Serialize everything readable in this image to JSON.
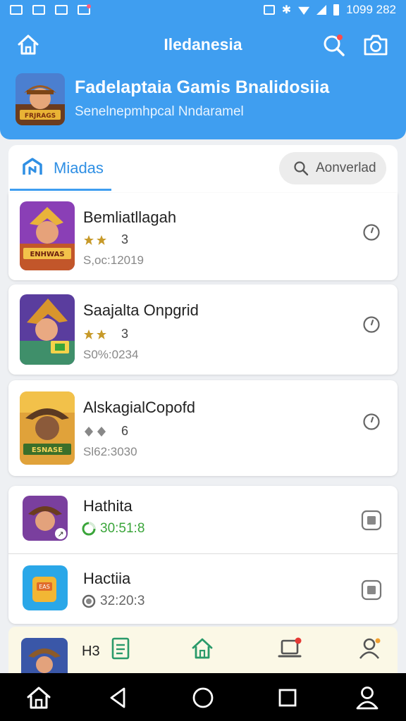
{
  "status_bar": {
    "time": "1099 282",
    "left_icons": [
      "image-icon",
      "chart-icon",
      "photo-icon",
      "gift-icon"
    ],
    "right_icons": [
      "nfc-icon",
      "vibrate-icon",
      "wifi-icon",
      "signal-icon",
      "battery-icon"
    ]
  },
  "header": {
    "title": "Iledanesia",
    "banner_title": "Fadelaptaia Gamis Bnalidosiia",
    "banner_subtitle": "Senelnepmhpcal Nndaramel"
  },
  "tabs": {
    "active_label": "Miadas",
    "search_placeholder": "Aonverlad"
  },
  "list": [
    {
      "title": "Bemliatllagah",
      "stars_filled": 2,
      "rating_count": "3",
      "meta": "S,oc:12019",
      "action_icon": "clock-icon"
    },
    {
      "title": "Saajalta Onpgrid",
      "stars_filled": 2,
      "rating_count": "3",
      "meta": "S0%:0234",
      "action_icon": "clock-icon"
    },
    {
      "title": "AlskagialCopofd",
      "stars_filled": 0,
      "rating_count": "6",
      "meta": "Sl62:3030",
      "action_icon": "clock-icon"
    }
  ],
  "installed": [
    {
      "title": "Hathita",
      "status": "30:51:8",
      "status_icon": "download-progress-icon",
      "status_color": "#3aa53a",
      "action_icon": "stop-icon"
    },
    {
      "title": "Hactiia",
      "status": "32:20:3",
      "status_icon": "clock-icon",
      "status_color": "#666666",
      "action_icon": "stop-icon"
    }
  ],
  "bottom_nav": {
    "label": "H3",
    "items": [
      "document-icon",
      "home-icon",
      "laptop-notification-icon",
      "profile-icon"
    ]
  },
  "colors": {
    "primary": "#3f9ef0",
    "star": "#c79a2a",
    "star_empty": "#888888",
    "success": "#3aa53a"
  }
}
